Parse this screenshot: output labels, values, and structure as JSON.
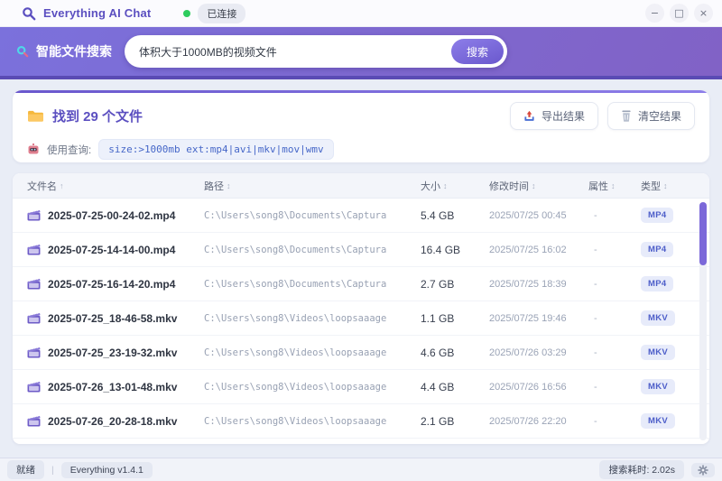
{
  "titlebar": {
    "app_title": "Everything AI Chat",
    "connection_status": "已连接",
    "minimize_glyph": "−",
    "maximize_glyph": "□",
    "close_glyph": "×"
  },
  "search": {
    "label": "智能文件搜索",
    "input_value": "体积大于1000MB的视频文件",
    "button_label": "搜索"
  },
  "results": {
    "found_text": "找到 29 个文件",
    "export_label": "导出结果",
    "clear_label": "清空结果",
    "query_label": "使用查询:",
    "query_value": "size:>1000mb ext:mp4|avi|mkv|mov|wmv"
  },
  "table": {
    "headers": [
      {
        "label": "文件名",
        "sort": "↑"
      },
      {
        "label": "路径",
        "sort": "↕"
      },
      {
        "label": "大小",
        "sort": "↕"
      },
      {
        "label": "修改时间",
        "sort": "↕"
      },
      {
        "label": "属性",
        "sort": "↕"
      },
      {
        "label": "类型",
        "sort": "↕"
      }
    ],
    "rows": [
      {
        "name": "2025-07-25-00-24-02.mp4",
        "path": "C:\\Users\\song8\\Documents\\Captura",
        "size": "5.4 GB",
        "modified": "2025/07/25 00:45",
        "attr": "-",
        "type": "MP4"
      },
      {
        "name": "2025-07-25-14-14-00.mp4",
        "path": "C:\\Users\\song8\\Documents\\Captura",
        "size": "16.4 GB",
        "modified": "2025/07/25 16:02",
        "attr": "-",
        "type": "MP4"
      },
      {
        "name": "2025-07-25-16-14-20.mp4",
        "path": "C:\\Users\\song8\\Documents\\Captura",
        "size": "2.7 GB",
        "modified": "2025/07/25 18:39",
        "attr": "-",
        "type": "MP4"
      },
      {
        "name": "2025-07-25_18-46-58.mkv",
        "path": "C:\\Users\\song8\\Videos\\loopsaaage",
        "size": "1.1 GB",
        "modified": "2025/07/25 19:46",
        "attr": "-",
        "type": "MKV"
      },
      {
        "name": "2025-07-25_23-19-32.mkv",
        "path": "C:\\Users\\song8\\Videos\\loopsaaage",
        "size": "4.6 GB",
        "modified": "2025/07/26 03:29",
        "attr": "-",
        "type": "MKV"
      },
      {
        "name": "2025-07-26_13-01-48.mkv",
        "path": "C:\\Users\\song8\\Videos\\loopsaaage",
        "size": "4.4 GB",
        "modified": "2025/07/26 16:56",
        "attr": "-",
        "type": "MKV"
      },
      {
        "name": "2025-07-26_20-28-18.mkv",
        "path": "C:\\Users\\song8\\Videos\\loopsaaage",
        "size": "2.1 GB",
        "modified": "2025/07/26 22:20",
        "attr": "-",
        "type": "MKV"
      }
    ]
  },
  "statusbar": {
    "ready_text": "就绪",
    "divider": "|",
    "version_text": "Everything v1.4.1",
    "elapsed_text": "搜索耗时: 2.02s"
  },
  "colors": {
    "accent_purple": "#6a58cd",
    "header_gradient_start": "#7b71dc",
    "header_gradient_end": "#8162c6",
    "connected_green": "#2ecc5e",
    "badge_bg": "#e7ebfa",
    "badge_text": "#4d5ec9",
    "query_text": "#4667c8"
  }
}
